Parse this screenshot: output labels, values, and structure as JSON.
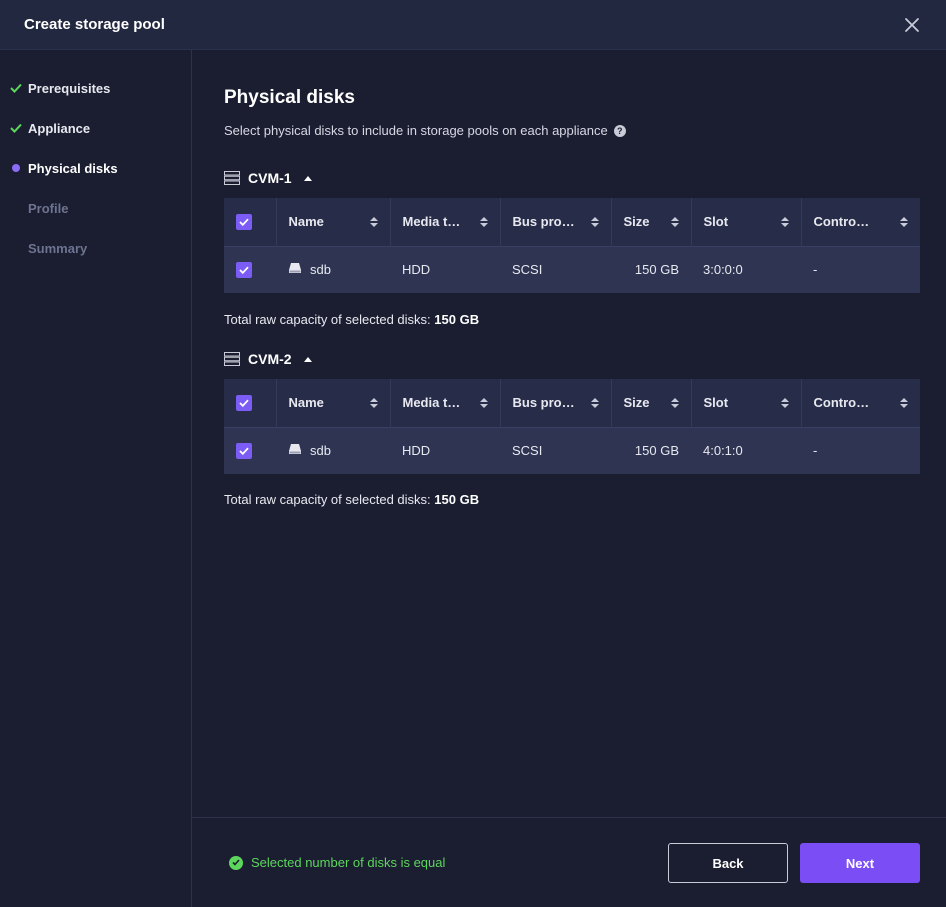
{
  "dialog": {
    "title": "Create storage pool"
  },
  "steps": [
    {
      "label": "Prerequisites",
      "state": "done"
    },
    {
      "label": "Appliance",
      "state": "done"
    },
    {
      "label": "Physical disks",
      "state": "active"
    },
    {
      "label": "Profile",
      "state": "pending"
    },
    {
      "label": "Summary",
      "state": "pending"
    }
  ],
  "main": {
    "title": "Physical disks",
    "subtitle": "Select physical disks to include in storage pools on each appliance"
  },
  "columns": [
    "Name",
    "Media t…",
    "Bus pro…",
    "Size",
    "Slot",
    "Contro…"
  ],
  "groups": [
    {
      "name": "CVM-1",
      "row": {
        "name": "sdb",
        "media": "HDD",
        "bus": "SCSI",
        "size": "150 GB",
        "slot": "3:0:0:0",
        "controller": "-"
      },
      "capacity_label": "Total raw capacity of selected disks:",
      "capacity_value": "150 GB"
    },
    {
      "name": "CVM-2",
      "row": {
        "name": "sdb",
        "media": "HDD",
        "bus": "SCSI",
        "size": "150 GB",
        "slot": "4:0:1:0",
        "controller": "-"
      },
      "capacity_label": "Total raw capacity of selected disks:",
      "capacity_value": "150 GB"
    }
  ],
  "footer": {
    "status": "Selected number of disks is equal",
    "back_label": "Back",
    "next_label": "Next"
  },
  "colors": {
    "accent": "#7b4df5",
    "success": "#5cd65c",
    "background": "#1b1e31"
  }
}
